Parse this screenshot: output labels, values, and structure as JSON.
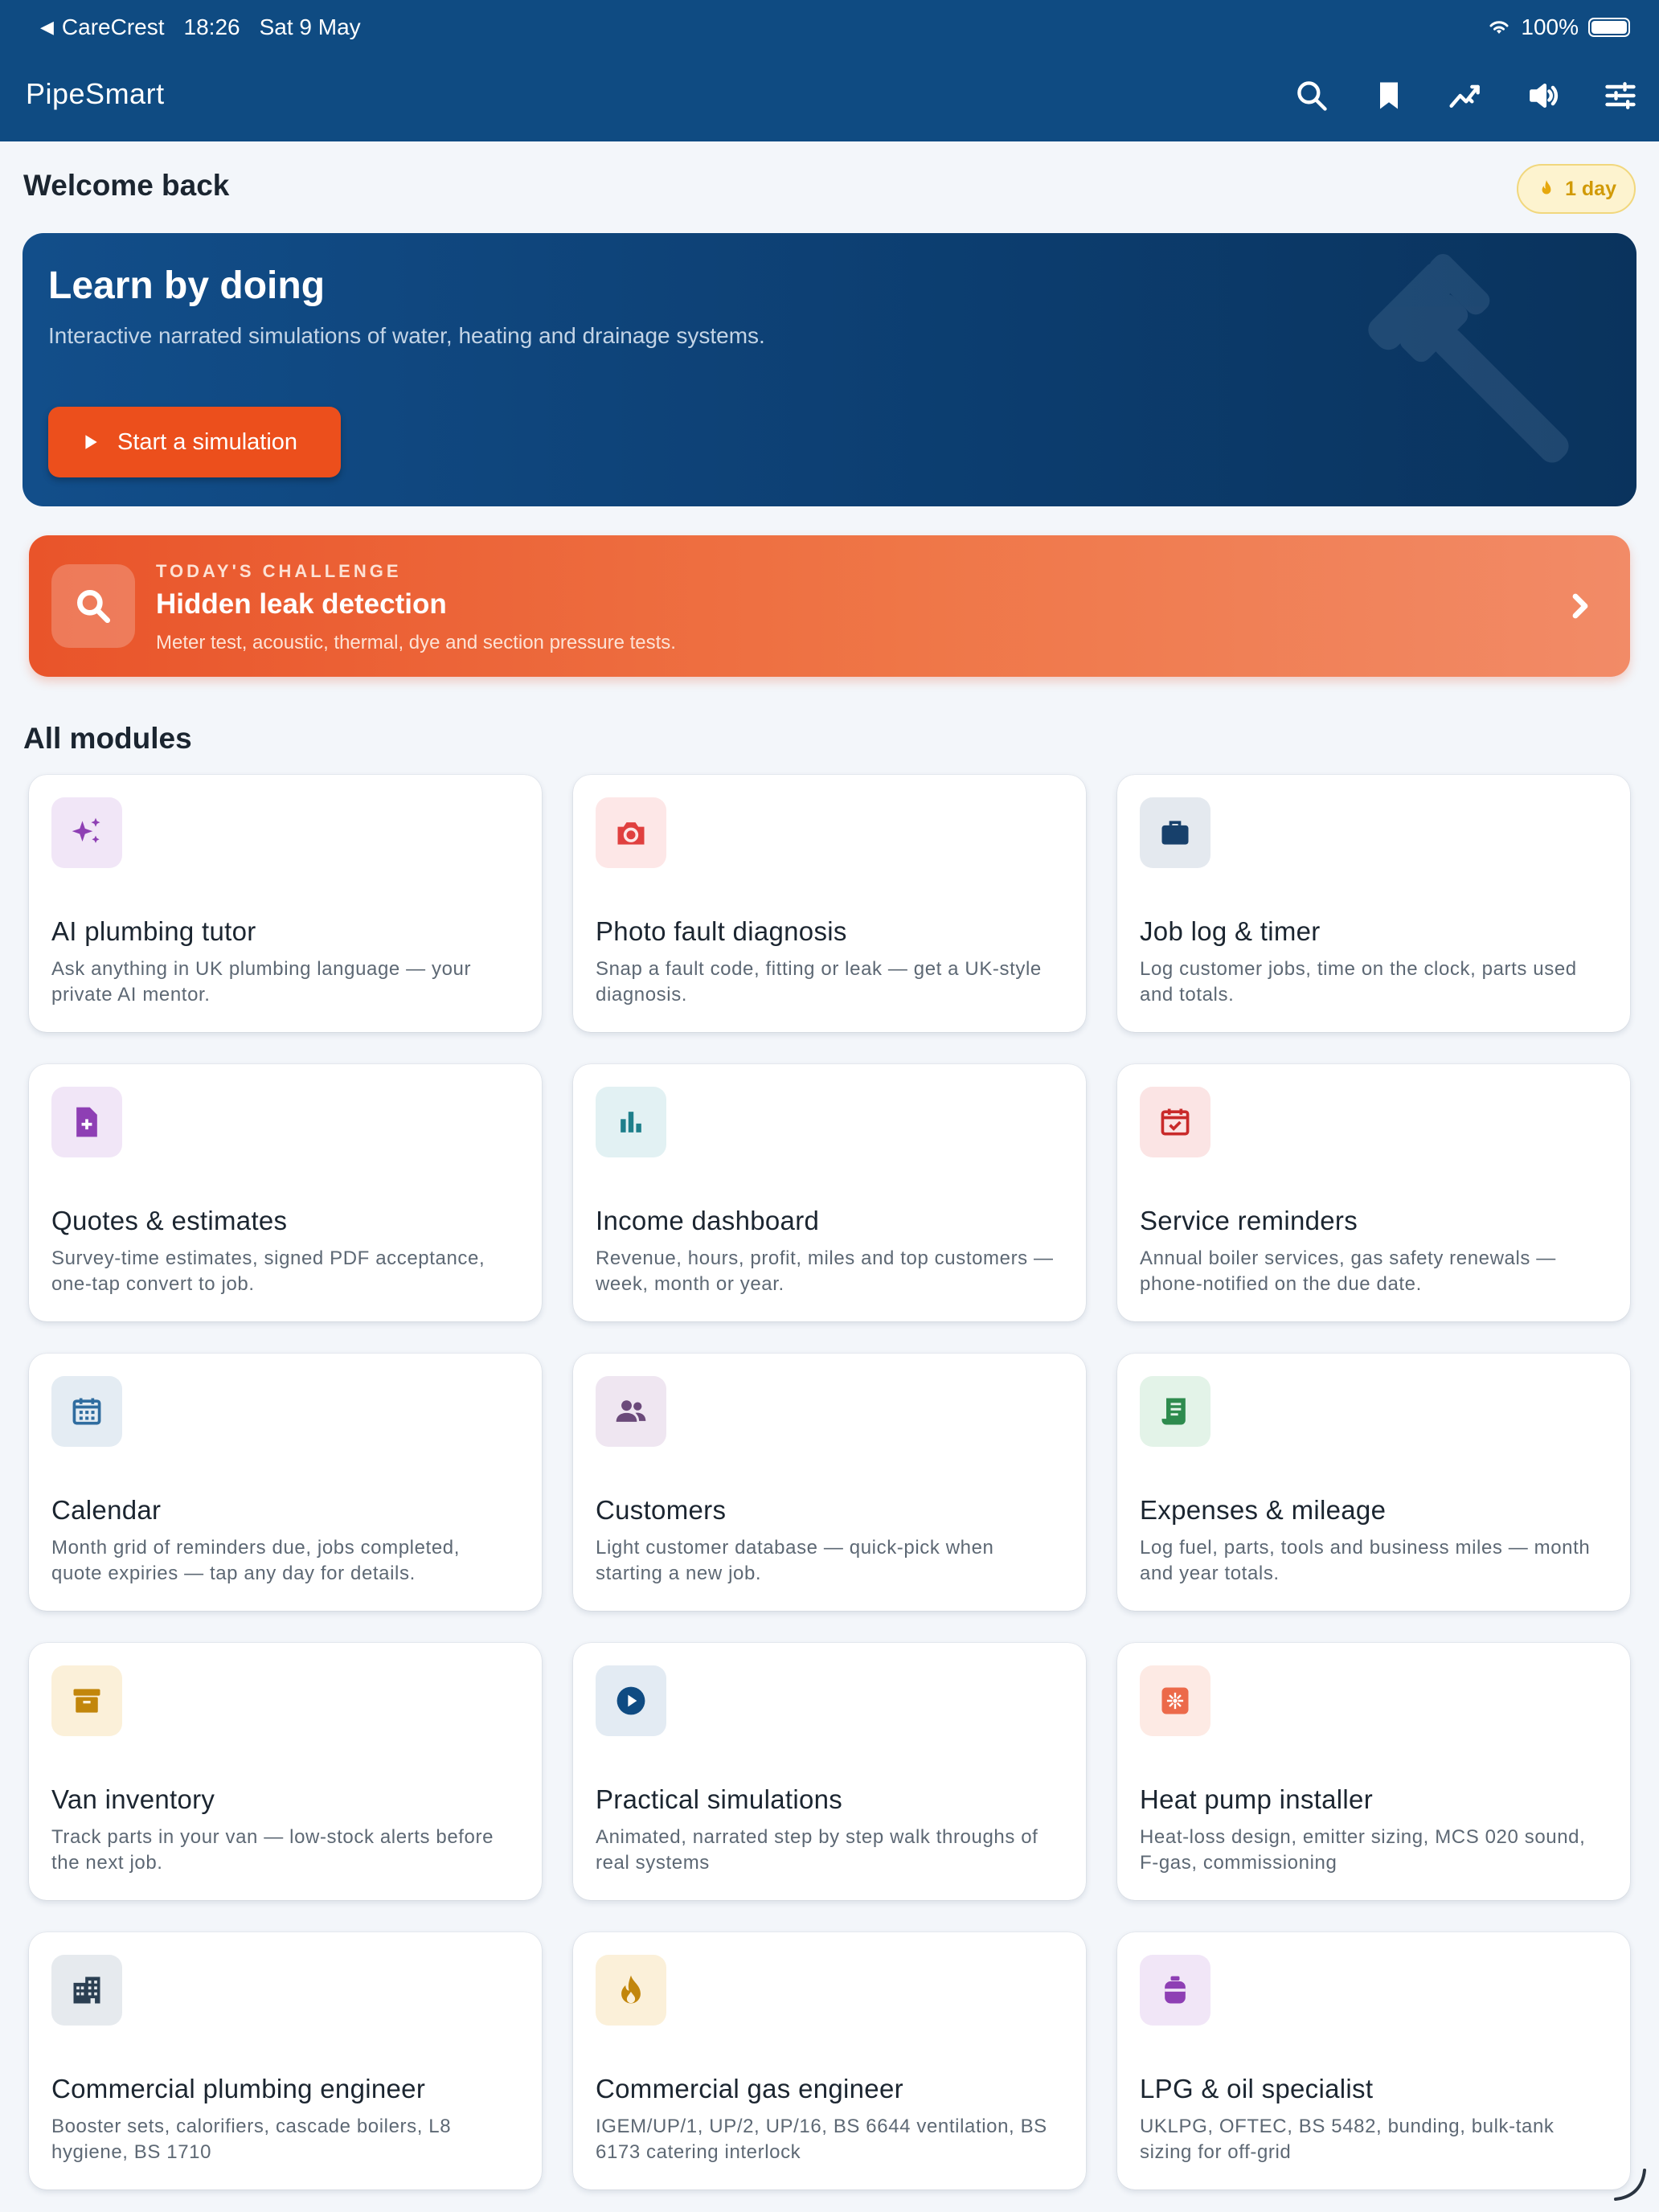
{
  "status_bar": {
    "back_app": "CareCrest",
    "time": "18:26",
    "date": "Sat 9 May",
    "battery": "100%"
  },
  "app": {
    "title": "PipeSmart",
    "icons": [
      "search-icon",
      "bookmark-icon",
      "progress-chart-icon",
      "volume-icon",
      "settings-sliders-icon"
    ]
  },
  "welcome": {
    "heading": "Welcome back",
    "streak": "1 day"
  },
  "hero": {
    "title": "Learn by doing",
    "subtitle": "Interactive narrated simulations of water, heating and drainage systems.",
    "button": "Start a simulation"
  },
  "challenge": {
    "kicker": "TODAY'S CHALLENGE",
    "title": "Hidden leak detection",
    "subtitle": "Meter test, acoustic, thermal, dye and section pressure tests."
  },
  "modules": {
    "heading": "All modules",
    "items": [
      {
        "title": "AI plumbing tutor",
        "desc": "Ask anything in UK plumbing language — your private AI mentor.",
        "icon": "sparkles-icon",
        "color": "#8e3fb4",
        "bg": "#f1e6f7"
      },
      {
        "title": "Photo fault diagnosis",
        "desc": "Snap a fault code, fitting or leak — get a UK-style diagnosis.",
        "icon": "camera-icon",
        "color": "#e0403f",
        "bg": "#fde7e7"
      },
      {
        "title": "Job log & timer",
        "desc": "Log customer jobs, time on the clock, parts used and totals.",
        "icon": "briefcase-icon",
        "color": "#17406b",
        "bg": "#e4e9ef"
      },
      {
        "title": "Quotes & estimates",
        "desc": "Survey-time estimates, signed PDF acceptance, one-tap convert to job.",
        "icon": "document-add-icon",
        "color": "#8e3fb4",
        "bg": "#f1e6f7"
      },
      {
        "title": "Income dashboard",
        "desc": "Revenue, hours, profit, miles and top customers — week, month or year.",
        "icon": "bar-chart-icon",
        "color": "#1e7f8b",
        "bg": "#e2f1f3"
      },
      {
        "title": "Service reminders",
        "desc": "Annual boiler services, gas safety renewals — phone-notified on the due date.",
        "icon": "calendar-check-icon",
        "color": "#c92a2a",
        "bg": "#fbe4e4"
      },
      {
        "title": "Calendar",
        "desc": "Month grid of reminders due, jobs completed, quote expiries — tap any day for details.",
        "icon": "calendar-icon",
        "color": "#2f6c9f",
        "bg": "#e4ecf3"
      },
      {
        "title": "Customers",
        "desc": "Light customer database — quick-pick when starting a new job.",
        "icon": "people-icon",
        "color": "#6b4a7a",
        "bg": "#efe6f1"
      },
      {
        "title": "Expenses & mileage",
        "desc": "Log fuel, parts, tools and business miles — month and year totals.",
        "icon": "receipt-icon",
        "color": "#2e8b4e",
        "bg": "#e3f3e8"
      },
      {
        "title": "Van inventory",
        "desc": "Track parts in your van — low-stock alerts before the next job.",
        "icon": "archive-box-icon",
        "color": "#c2860b",
        "bg": "#fbf0d9"
      },
      {
        "title": "Practical simulations",
        "desc": "Animated, narrated step by step walk throughs of real systems",
        "icon": "play-circle-icon",
        "color": "#0f4b82",
        "bg": "#e3ebf3"
      },
      {
        "title": "Heat pump installer",
        "desc": "Heat-loss design, emitter sizing, MCS 020 sound, F-gas, commissioning",
        "icon": "fan-icon",
        "color": "#ec6a4a",
        "bg": "#fdeae4"
      },
      {
        "title": "Commercial plumbing engineer",
        "desc": "Booster sets, calorifiers, cascade boilers, L8 hygiene, BS 1710",
        "icon": "building-icon",
        "color": "#2b3f52",
        "bg": "#e6eaee"
      },
      {
        "title": "Commercial gas engineer",
        "desc": "IGEM/UP/1, UP/2, UP/16, BS 6644 ventilation, BS 6173 catering interlock",
        "icon": "flame-icon",
        "color": "#c2860b",
        "bg": "#fbf0d9"
      },
      {
        "title": "LPG & oil specialist",
        "desc": "UKLPG, OFTEC, BS 5482, bunding, bulk-tank sizing for off-grid",
        "icon": "gas-bottle-icon",
        "color": "#8e3fb4",
        "bg": "#f1e6f7"
      }
    ]
  }
}
